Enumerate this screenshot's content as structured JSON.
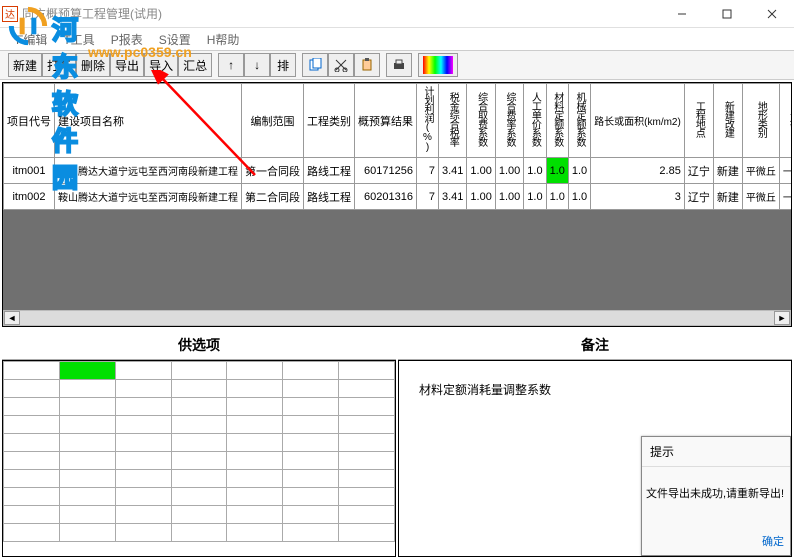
{
  "window": {
    "title": "同方概预算工程管理(试用)",
    "icon_text": "达"
  },
  "menu": {
    "items": [
      "F编辑",
      "T工具",
      "P报表",
      "S设置",
      "H帮助"
    ]
  },
  "toolbar": {
    "new": "新建",
    "open": "打开",
    "delete": "删除",
    "export": "导出",
    "import": "导入",
    "summary": "汇总",
    "up": "↑",
    "down": "↓",
    "sort": "排"
  },
  "watermark": {
    "text": "河东软件园",
    "url": "www.pc0359.cn"
  },
  "columns": {
    "c1": "项目代号",
    "c2": "建设项目名称",
    "c3": "编制范围",
    "c4": "工程类别",
    "c5": "概预算结果",
    "c6": "计划利润(%)",
    "c7": "税金综合税率",
    "c8": "综合取费系数",
    "c9": "综合费率系数",
    "c10": "人工单价系数",
    "c11": "材料定额系数",
    "c12": "机械定额系数",
    "c13": "路长或面积(km/m2)",
    "c14": "工程地点",
    "c15": "新建改建",
    "c16": "地形类别",
    "c17": "公等"
  },
  "rows": [
    {
      "id": "itm001",
      "name": "鞍山腾达大道宁远屯至西河南段新建工程",
      "scope": "第一合同段",
      "type": "路线工程",
      "result": "60171256",
      "r6": "7",
      "r7": "3.41",
      "r8": "1.00",
      "r9": "1.00",
      "r10": "1.0",
      "r11": "1.0",
      "r12": "1.0",
      "r13": "2.85",
      "r14": "辽宁",
      "r15": "新建",
      "r16": "平微丘",
      "r17": "一公"
    },
    {
      "id": "itm002",
      "name": "鞍山腾达大道宁远屯至西河南段新建工程",
      "scope": "第二合同段",
      "type": "路线工程",
      "result": "60201316",
      "r6": "7",
      "r7": "3.41",
      "r8": "1.00",
      "r9": "1.00",
      "r10": "1.0",
      "r11": "1.0",
      "r12": "1.0",
      "r13": "3",
      "r14": "辽宁",
      "r15": "新建",
      "r16": "平微丘",
      "r17": "一公"
    }
  ],
  "panels": {
    "left_title": "供选项",
    "right_title": "备注"
  },
  "remark_text": "材料定额消耗量调整系数",
  "popup": {
    "title": "提示",
    "body": "文件导出未成功,请重新导出!",
    "ok": "确定"
  }
}
